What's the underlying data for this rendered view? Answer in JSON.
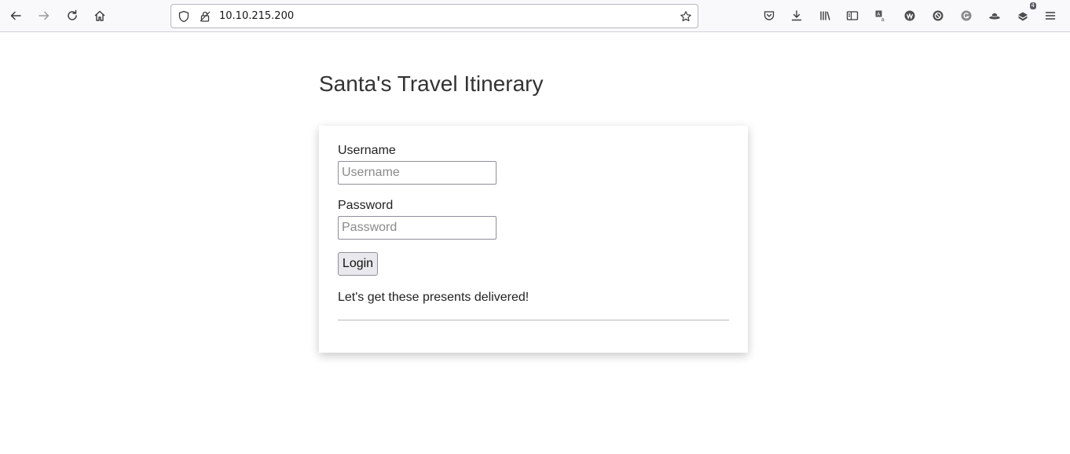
{
  "browser": {
    "url": "10.10.215.200",
    "extensions_badge": "4",
    "icons": {
      "back": "back-arrow-icon",
      "forward": "forward-arrow-icon",
      "reload": "reload-icon",
      "home": "home-icon",
      "shield": "tracking-protection-shield-icon",
      "lock": "connection-lock-icon",
      "bookmark": "bookmark-star-icon",
      "pocket": "pocket-icon",
      "downloads": "download-icon",
      "library": "library-icon",
      "sidebar": "sidebar-icon",
      "translate": "translate-icon",
      "wappalyzer": "wappalyzer-icon",
      "block": "block-icon",
      "extension_g": "grammarly-icon",
      "hat": "hat-extension-icon",
      "extensions": "extensions-icon",
      "menu": "hamburger-menu-icon"
    }
  },
  "page": {
    "title": "Santa's Travel Itinerary",
    "form": {
      "username_label": "Username",
      "username_placeholder": "Username",
      "username_value": "",
      "password_label": "Password",
      "password_placeholder": "Password",
      "password_value": "",
      "login_label": "Login"
    },
    "message": "Let's get these presents delivered!"
  }
}
